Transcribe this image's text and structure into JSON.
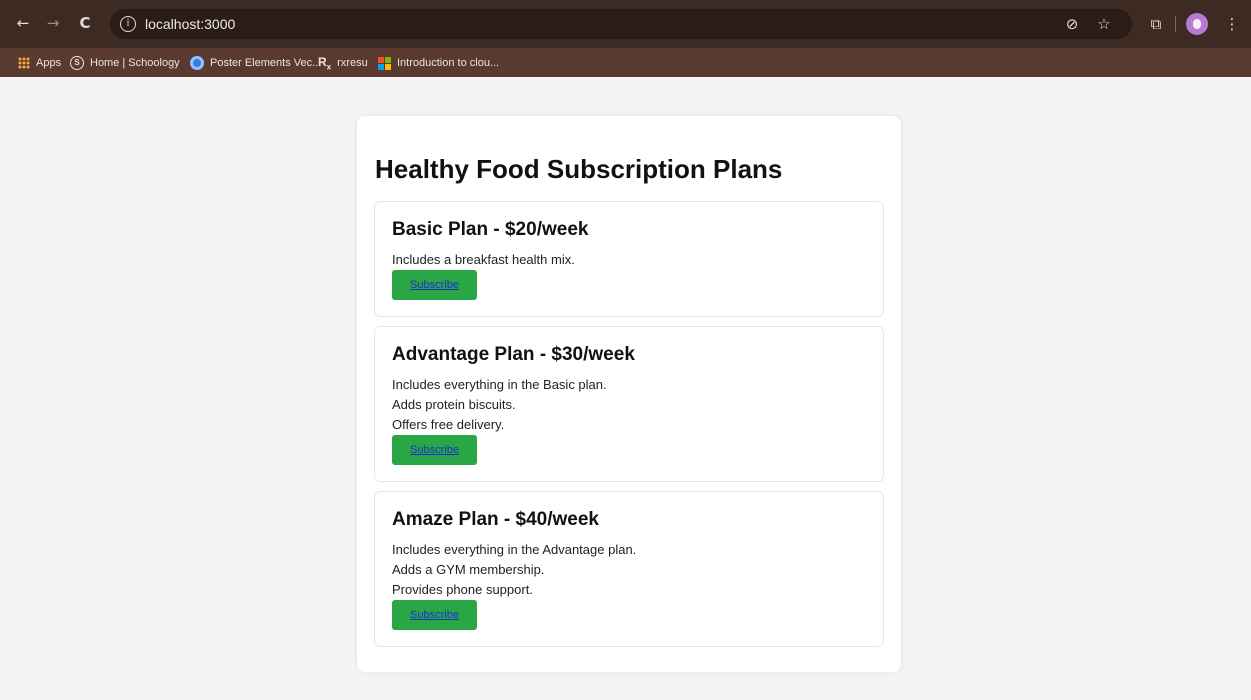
{
  "browser": {
    "url": "localhost:3000",
    "bookmarks": [
      {
        "label": "Apps"
      },
      {
        "label": "Home | Schoology"
      },
      {
        "label": "Poster Elements Vec..."
      },
      {
        "label": "rxresu"
      },
      {
        "label": "Introduction to clou..."
      }
    ],
    "icons": {
      "back": "←",
      "forward": "→",
      "reload": "C",
      "info": "i",
      "eye_off": "⊘",
      "star": "☆",
      "extensions": "⧉",
      "menu": "⋮"
    }
  },
  "page": {
    "title": "Healthy Food Subscription Plans",
    "plans": [
      {
        "title": "Basic Plan - $20/week",
        "features": [
          "Includes a breakfast health mix."
        ],
        "button": "Subscribe"
      },
      {
        "title": "Advantage Plan - $30/week",
        "features": [
          "Includes everything in the Basic plan.",
          "Adds protein biscuits.",
          "Offers free delivery."
        ],
        "button": "Subscribe"
      },
      {
        "title": "Amaze Plan - $40/week",
        "features": [
          "Includes everything in the Advantage plan.",
          "Adds a GYM membership.",
          "Provides phone support."
        ],
        "button": "Subscribe"
      }
    ]
  },
  "colors": {
    "chrome_top": "#3c2a23",
    "bookmark_bar": "#5a3a2e",
    "button_green": "#2aa745",
    "link_blue": "#1a2fd6"
  }
}
